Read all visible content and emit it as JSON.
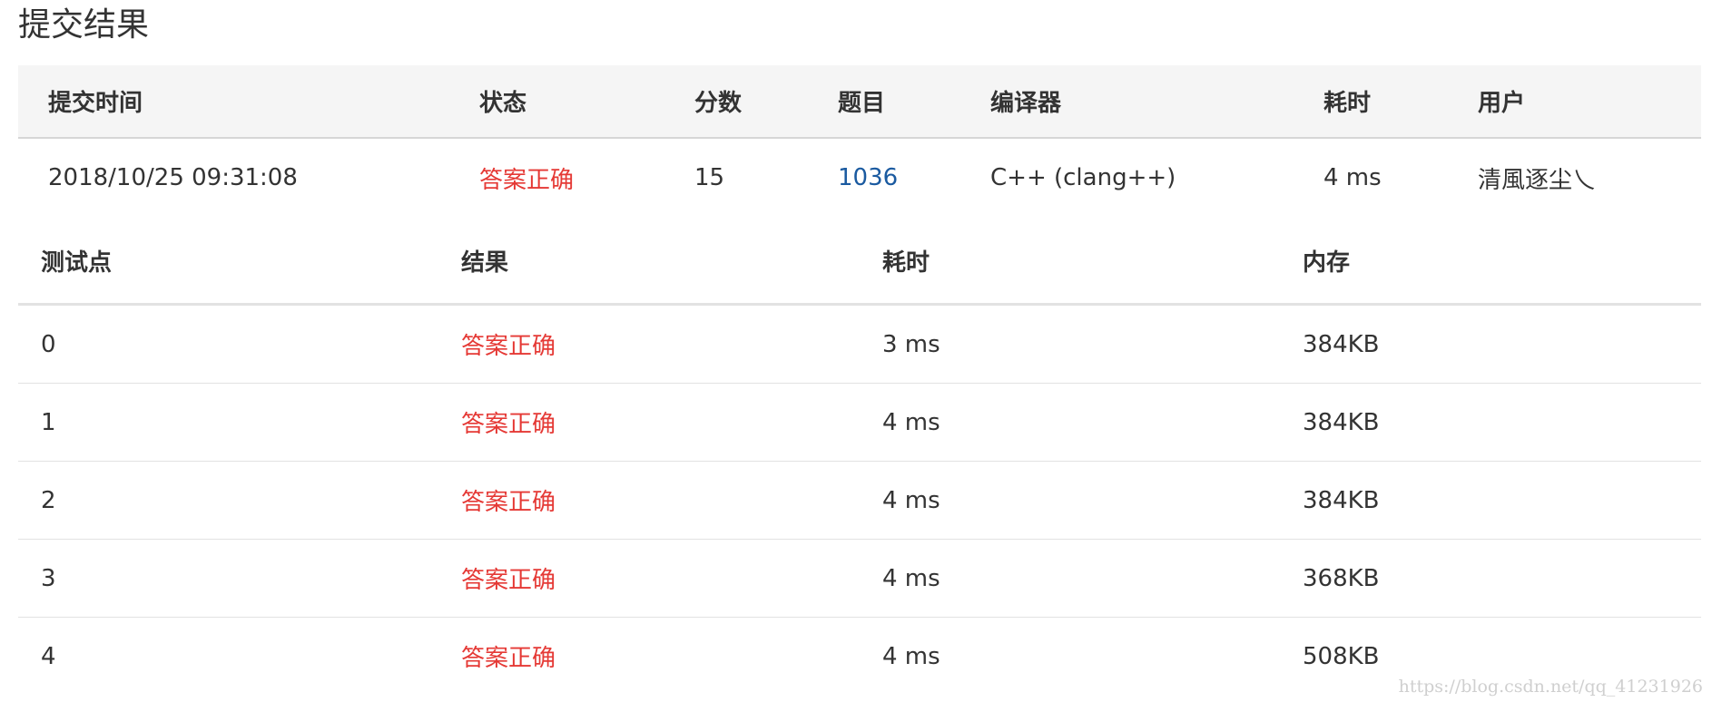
{
  "page_title": "提交结果",
  "submission": {
    "headers": {
      "time": "提交时间",
      "status": "状态",
      "score": "分数",
      "problem": "题目",
      "compiler": "编译器",
      "duration": "耗时",
      "user": "用户"
    },
    "row": {
      "time": "2018/10/25 09:31:08",
      "status": "答案正确",
      "score": "15",
      "problem": "1036",
      "compiler": "C++ (clang++)",
      "duration": "4 ms",
      "user": "清風逐尘乀"
    }
  },
  "testcases": {
    "headers": {
      "case": "测试点",
      "result": "结果",
      "duration": "耗时",
      "memory": "内存"
    },
    "rows": [
      {
        "case": "0",
        "result": "答案正确",
        "duration": "3 ms",
        "memory": "384KB"
      },
      {
        "case": "1",
        "result": "答案正确",
        "duration": "4 ms",
        "memory": "384KB"
      },
      {
        "case": "2",
        "result": "答案正确",
        "duration": "4 ms",
        "memory": "384KB"
      },
      {
        "case": "3",
        "result": "答案正确",
        "duration": "4 ms",
        "memory": "368KB"
      },
      {
        "case": "4",
        "result": "答案正确",
        "duration": "4 ms",
        "memory": "508KB"
      }
    ]
  },
  "watermark": "https://blog.csdn.net/qq_41231926",
  "colors": {
    "accepted": "#e53935",
    "link": "#1a5aa0",
    "header_bg": "#f5f5f5"
  }
}
